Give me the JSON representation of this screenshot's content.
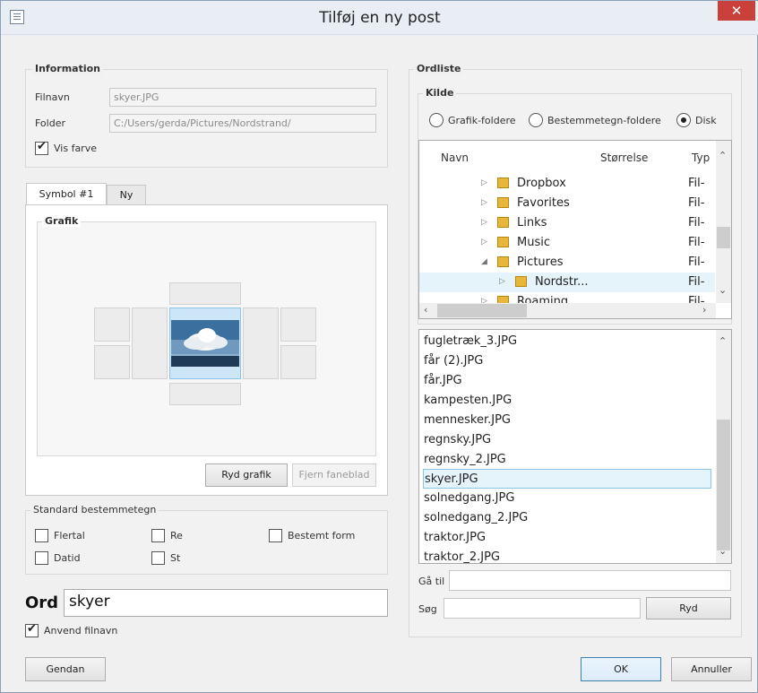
{
  "window": {
    "title": "Tilføj en ny post",
    "close_label": "✕"
  },
  "information": {
    "group_label": "Information",
    "filnavn_label": "Filnavn",
    "filnavn_value": "skyer.JPG",
    "folder_label": "Folder",
    "folder_value": "C:/Users/gerda/Pictures/Nordstrand/",
    "vis_farve_label": "Vis farve",
    "vis_farve_checked": true
  },
  "symbol_tabs": [
    {
      "label": "Symbol #1",
      "active": true
    },
    {
      "label": "Ny",
      "active": false
    }
  ],
  "grafik": {
    "group_label": "Grafik",
    "ryd_grafik_label": "Ryd grafik",
    "fjern_faneblad_label": "Fjern faneblad"
  },
  "standard": {
    "group_label": "Standard bestemmetegn",
    "options": [
      {
        "label": "Flertal",
        "checked": false
      },
      {
        "label": "Re",
        "checked": false
      },
      {
        "label": "Bestemt form",
        "checked": false
      },
      {
        "label": "Datid",
        "checked": false
      },
      {
        "label": "St",
        "checked": false
      }
    ]
  },
  "ord": {
    "label": "Ord",
    "value": "skyer"
  },
  "anvend_filnavn": {
    "label": "Anvend filnavn",
    "checked": true
  },
  "ordliste": {
    "group_label": "Ordliste",
    "kilde": {
      "group_label": "Kilde",
      "options": [
        {
          "label": "Grafik-foldere",
          "checked": false
        },
        {
          "label": "Bestemmetegn-foldere",
          "checked": false
        },
        {
          "label": "Disk",
          "checked": true
        }
      ]
    },
    "tree": {
      "headers": {
        "name": "Navn",
        "size": "Størrelse",
        "type": "Typ"
      },
      "rows": [
        {
          "name": "Dropbox",
          "type": "Fil-",
          "expander": "▷"
        },
        {
          "name": "Favorites",
          "type": "Fil-",
          "expander": "▷"
        },
        {
          "name": "Links",
          "type": "Fil-",
          "expander": "▷"
        },
        {
          "name": "Music",
          "type": "Fil-",
          "expander": "▷"
        },
        {
          "name": "Pictures",
          "type": "Fil-",
          "expander": "◢"
        },
        {
          "name": "Nordstr...",
          "type": "Fil-",
          "expander": "▷"
        },
        {
          "name": "Roaming",
          "type": "Fil-",
          "expander": "▷"
        }
      ]
    },
    "files": [
      "fugletræk_3.JPG",
      "får (2).JPG",
      "får.JPG",
      "kampesten.JPG",
      "mennesker.JPG",
      "regnsky.JPG",
      "regnsky_2.JPG",
      "skyer.JPG",
      "solnedgang.JPG",
      "solnedgang_2.JPG",
      "traktor.JPG",
      "traktor_2.JPG"
    ],
    "selected_file": "skyer.JPG",
    "gaa_til_label": "Gå til",
    "gaa_til_value": "",
    "soeg_label": "Søg",
    "soeg_value": "",
    "ryd_label": "Ryd"
  },
  "footer": {
    "gendan_label": "Gendan",
    "ok_label": "OK",
    "annuller_label": "Annuller"
  }
}
